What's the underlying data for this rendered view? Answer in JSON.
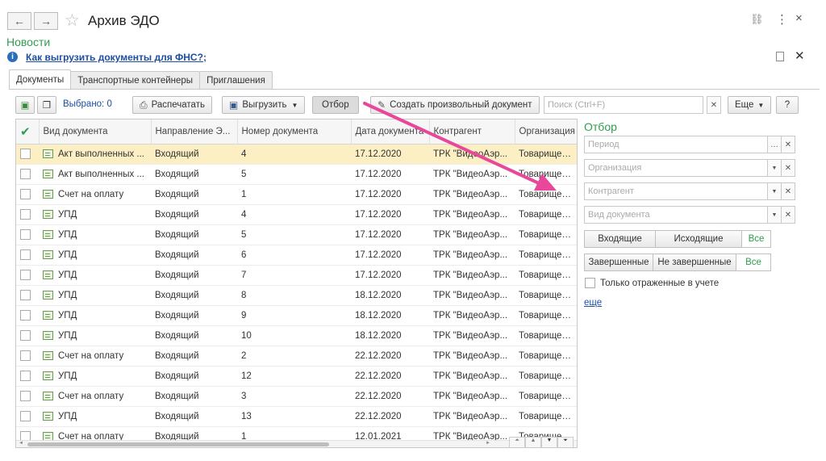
{
  "window": {
    "title": "Архив ЭДО",
    "back_glyph": "←",
    "forward_glyph": "→",
    "star_glyph": "☆",
    "link_glyph": "⛓",
    "more_glyph": "⋮",
    "close_glyph": "×"
  },
  "news": {
    "label": "Новости",
    "info_glyph": "i",
    "link": "Как выгрузить документы для ФНС?",
    "suffix": ";",
    "close_glyph": "✕"
  },
  "tabs": [
    {
      "label": "Документы",
      "active": true
    },
    {
      "label": "Транспортные контейнеры",
      "active": false
    },
    {
      "label": "Приглашения",
      "active": false
    }
  ],
  "toolbar": {
    "selected": "Выбрано: 0",
    "print": "Распечатать",
    "export": "Выгрузить",
    "filter": "Отбор",
    "create": "Создать произвольный документ",
    "search_placeholder": "Поиск (Ctrl+F)",
    "more": "Еще",
    "help": "?"
  },
  "table": {
    "columns": [
      "Вид документа",
      "Направление Э...",
      "Номер документа",
      "Дата документа",
      "Контрагент",
      "Организация"
    ],
    "rows": [
      {
        "type": "Акт выполненных ...",
        "dir": "Входящий",
        "num": "4",
        "date": "17.12.2020",
        "contr": "ТРК \"ВидеоАэр...",
        "org": "Товариществ"
      },
      {
        "type": "Акт выполненных ...",
        "dir": "Входящий",
        "num": "5",
        "date": "17.12.2020",
        "contr": "ТРК \"ВидеоАэр...",
        "org": "Товариществ"
      },
      {
        "type": "Счет на оплату",
        "dir": "Входящий",
        "num": "1",
        "date": "17.12.2020",
        "contr": "ТРК \"ВидеоАэр...",
        "org": "Товариществ"
      },
      {
        "type": "УПД",
        "dir": "Входящий",
        "num": "4",
        "date": "17.12.2020",
        "contr": "ТРК \"ВидеоАэр...",
        "org": "Товариществ"
      },
      {
        "type": "УПД",
        "dir": "Входящий",
        "num": "5",
        "date": "17.12.2020",
        "contr": "ТРК \"ВидеоАэр...",
        "org": "Товариществ"
      },
      {
        "type": "УПД",
        "dir": "Входящий",
        "num": "6",
        "date": "17.12.2020",
        "contr": "ТРК \"ВидеоАэр...",
        "org": "Товариществ"
      },
      {
        "type": "УПД",
        "dir": "Входящий",
        "num": "7",
        "date": "17.12.2020",
        "contr": "ТРК \"ВидеоАэр...",
        "org": "Товариществ"
      },
      {
        "type": "УПД",
        "dir": "Входящий",
        "num": "8",
        "date": "18.12.2020",
        "contr": "ТРК \"ВидеоАэр...",
        "org": "Товариществ"
      },
      {
        "type": "УПД",
        "dir": "Входящий",
        "num": "9",
        "date": "18.12.2020",
        "contr": "ТРК \"ВидеоАэр...",
        "org": "Товариществ"
      },
      {
        "type": "УПД",
        "dir": "Входящий",
        "num": "10",
        "date": "18.12.2020",
        "contr": "ТРК \"ВидеоАэр...",
        "org": "Товариществ"
      },
      {
        "type": "Счет на оплату",
        "dir": "Входящий",
        "num": "2",
        "date": "22.12.2020",
        "contr": "ТРК \"ВидеоАэр...",
        "org": "Товариществ"
      },
      {
        "type": "УПД",
        "dir": "Входящий",
        "num": "12",
        "date": "22.12.2020",
        "contr": "ТРК \"ВидеоАэр...",
        "org": "Товариществ"
      },
      {
        "type": "Счет на оплату",
        "dir": "Входящий",
        "num": "3",
        "date": "22.12.2020",
        "contr": "ТРК \"ВидеоАэр...",
        "org": "Товариществ"
      },
      {
        "type": "УПД",
        "dir": "Входящий",
        "num": "13",
        "date": "22.12.2020",
        "contr": "ТРК \"ВидеоАэр...",
        "org": "Товариществ"
      },
      {
        "type": "Счет на оплату",
        "dir": "Входящий",
        "num": "1",
        "date": "12.01.2021",
        "contr": "ТРК \"ВидеоАэр...",
        "org": "Товариществ"
      }
    ]
  },
  "filter_panel": {
    "title": "Отбор",
    "period_placeholder": "Период",
    "org_placeholder": "Организация",
    "contr_placeholder": "Контрагент",
    "doctype_placeholder": "Вид документа",
    "dir_buttons": [
      "Входящие",
      "Исходящие",
      "Все"
    ],
    "state_buttons": [
      "Завершенные",
      "Не завершенные",
      "Все"
    ],
    "only_reflected": "Только отраженные в учете",
    "more_link": "еще"
  },
  "colors": {
    "accent_green": "#2e9e4f",
    "link_blue": "#1c4ea3",
    "selected_row": "#fbefc3",
    "arrow": "#e8479a"
  }
}
